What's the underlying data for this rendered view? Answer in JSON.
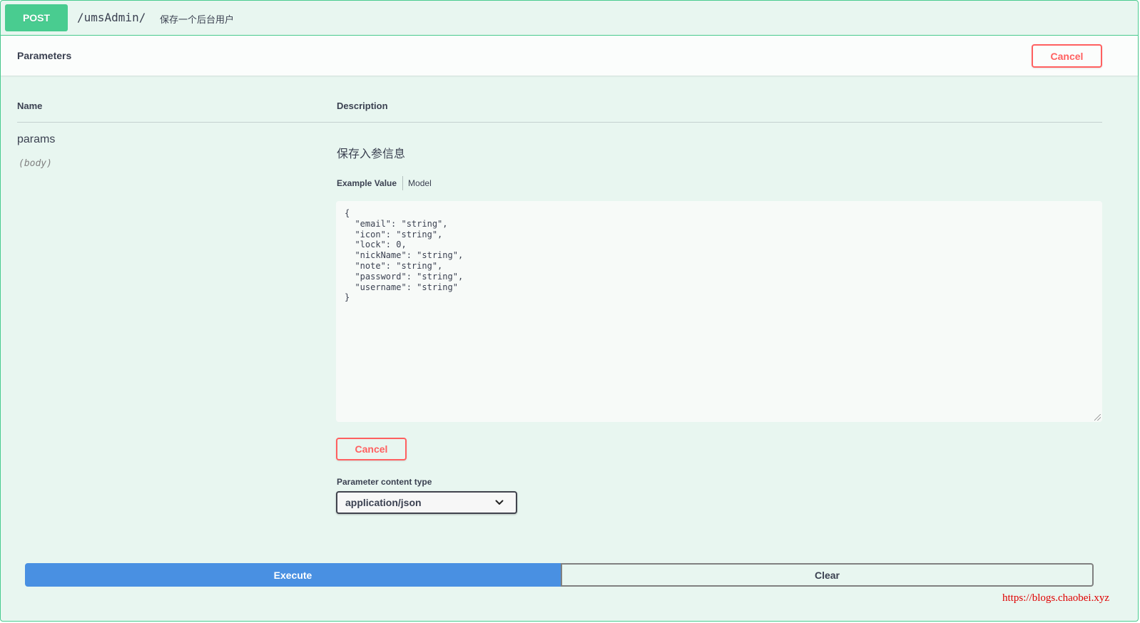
{
  "summary": {
    "method": "POST",
    "path": "/umsAdmin/",
    "description": "保存一个后台用户"
  },
  "parameters_header": {
    "title": "Parameters",
    "cancel_label": "Cancel"
  },
  "table": {
    "col_name": "Name",
    "col_description": "Description"
  },
  "param": {
    "name": "params",
    "in": "(body)",
    "description": "保存入参信息"
  },
  "tabs": {
    "example_value": "Example Value",
    "model": "Model"
  },
  "body_value": "{\n  \"email\": \"string\",\n  \"icon\": \"string\",\n  \"lock\": 0,\n  \"nickName\": \"string\",\n  \"note\": \"string\",\n  \"password\": \"string\",\n  \"username\": \"string\"\n}",
  "body_cancel_label": "Cancel",
  "content_type": {
    "label": "Parameter content type",
    "selected": "application/json"
  },
  "actions": {
    "execute_label": "Execute",
    "clear_label": "Clear"
  },
  "watermark": "https://blogs.chaobei.xyz",
  "colors": {
    "post": "#49cc90",
    "post_bg": "#e8f6f0",
    "cancel": "#ff6060",
    "execute": "#4990e2"
  }
}
